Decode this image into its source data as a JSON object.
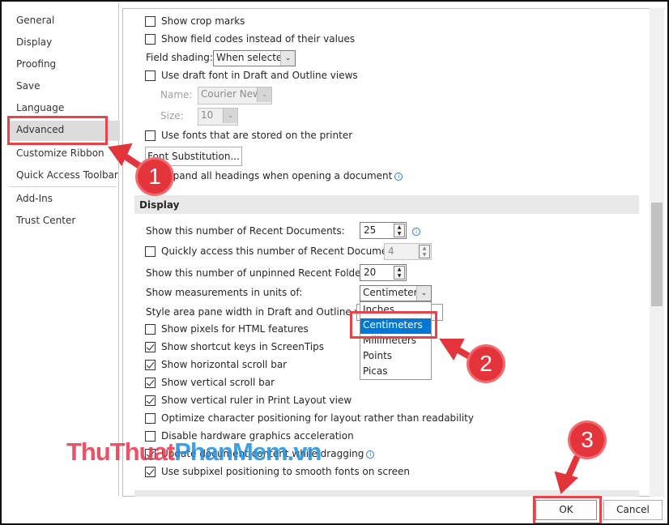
{
  "sidebar": {
    "items": [
      {
        "label": "General"
      },
      {
        "label": "Display"
      },
      {
        "label": "Proofing"
      },
      {
        "label": "Save"
      },
      {
        "label": "Language"
      },
      {
        "label": "Advanced",
        "selected": true
      },
      {
        "label": "Customize Ribbon"
      },
      {
        "label": "Quick Access Toolbar"
      },
      {
        "label": "Add-Ins"
      },
      {
        "label": "Trust Center"
      }
    ]
  },
  "show_doc": {
    "crop_marks": {
      "label": "Show crop marks",
      "checked": false
    },
    "field_codes": {
      "label": "Show field codes instead of their values",
      "checked": false
    },
    "field_shading": {
      "label": "Field shading:",
      "value": "When selected"
    },
    "draft_font": {
      "label": "Use draft font in Draft and Outline views",
      "checked": false
    },
    "name": {
      "label": "Name:",
      "value": "Courier New"
    },
    "size": {
      "label": "Size:",
      "value": "10"
    },
    "printer_fonts": {
      "label": "Use fonts that are stored on the printer",
      "checked": false
    },
    "font_substitution": "Font Substitution...",
    "expand_headings": {
      "label": "Expand all headings when opening a document"
    }
  },
  "display": {
    "header": "Display",
    "recent_docs": {
      "label": "Show this number of Recent Documents:",
      "value": "25"
    },
    "quick_access": {
      "label": "Quickly access this number of Recent Documents:",
      "value": "4",
      "checked": false
    },
    "recent_folders": {
      "label": "Show this number of unpinned Recent Folders:",
      "value": "20"
    },
    "units": {
      "label": "Show measurements in units of:",
      "value": "Centimeters",
      "options": [
        "Inches",
        "Centimeters",
        "Millimeters",
        "Points",
        "Picas"
      ],
      "highlighted": "Centimeters"
    },
    "style_area": {
      "label": "Style area pane width in Draft and Outline views:"
    },
    "checks": [
      {
        "label": "Show pixels for HTML features",
        "checked": false
      },
      {
        "label": "Show shortcut keys in ScreenTips",
        "checked": true
      },
      {
        "label": "Show horizontal scroll bar",
        "checked": true
      },
      {
        "label": "Show vertical scroll bar",
        "checked": true
      },
      {
        "label": "Show vertical ruler in Print Layout view",
        "checked": true
      },
      {
        "label": "Optimize character positioning for layout rather than readability",
        "checked": false
      },
      {
        "label": "Disable hardware graphics acceleration",
        "checked": false
      },
      {
        "label": "Update document content while dragging",
        "checked": true
      },
      {
        "label": "Use subpixel positioning to smooth fonts on screen",
        "checked": true
      }
    ]
  },
  "footer": {
    "ok": "OK",
    "cancel": "Cancel"
  },
  "annotations": {
    "step1": "1",
    "step2": "2",
    "step3": "3",
    "color": "#e3343b"
  },
  "watermark": {
    "part1": "ThuThuat",
    "part2": "PhanMem",
    "part3": ".vn",
    "color1": "#e8364a",
    "color2": "#1e8fe0"
  }
}
